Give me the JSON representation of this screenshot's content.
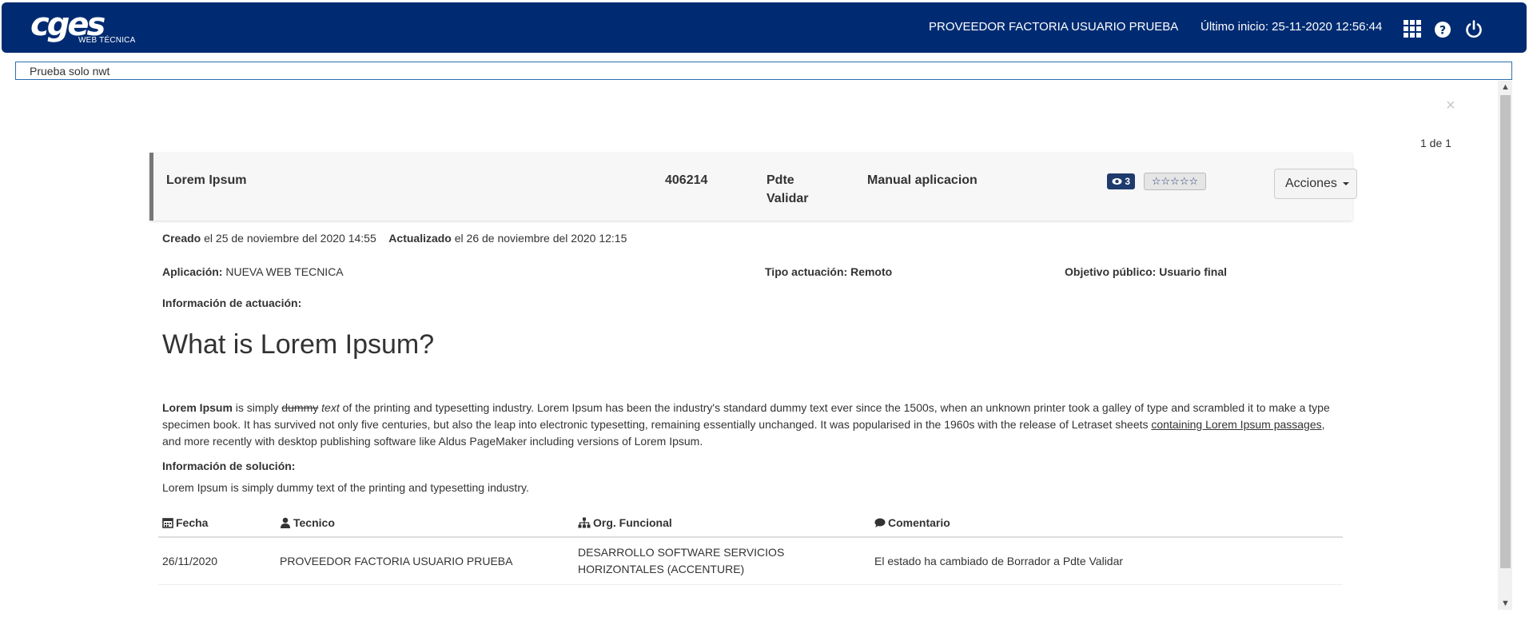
{
  "header": {
    "logo_text": "cges",
    "logo_subtitle": "WEB TÉCNICA",
    "user_name": "PROVEEDOR FACTORIA USUARIO PRUEBA",
    "last_login": "Último inicio: 25-11-2020 12:56:44",
    "icons": [
      "apps-grid-icon",
      "help-icon",
      "power-icon"
    ]
  },
  "notice": "Prueba solo nwt",
  "pager": "1 de 1",
  "close_label": "×",
  "ticket": {
    "title": "Lorem Ipsum",
    "id": "406214",
    "status": "Pdte Validar",
    "type": "Manual aplicacion",
    "views": "3",
    "rating": "☆☆☆☆☆",
    "actions_label": "Acciones"
  },
  "meta": {
    "created_label": "Creado",
    "created_value": " el 25 de noviembre del 2020 14:55",
    "updated_label": "Actualizado",
    "updated_value": " el 26 de noviembre del 2020 12:15",
    "app_label": "Aplicación:",
    "app_value": " NUEVA WEB TECNICA",
    "tipo": "Tipo actuación: Remoto",
    "objetivo": "Objetivo público: Usuario final",
    "info_label": "Información de actuación:"
  },
  "article": {
    "heading": "What is Lorem Ipsum?",
    "bold_lead": "Lorem Ipsum",
    "text_1": " is simply ",
    "strike": "dummy",
    "italic": " text",
    "text_2": " of the printing and typesetting industry. Lorem Ipsum has been the industry's standard dummy text ever since the 1500s, when an unknown printer took a galley of type and scrambled it to make a type specimen book. It has survived not only five centuries, but also the leap into electronic typesetting, remaining essentially unchanged. It was popularised in the 1960s with the release of Letraset sheets ",
    "link": "containing Lorem Ipsum passages",
    "text_3": ", and more recently with desktop publishing software like Aldus PageMaker including versions of Lorem Ipsum."
  },
  "solution": {
    "label": "Información de solución:",
    "text": "Lorem Ipsum is simply dummy text of the printing and typesetting industry."
  },
  "history": {
    "columns": [
      "Fecha",
      "Tecnico",
      "Org. Funcional",
      "Comentario"
    ],
    "rows": [
      {
        "fecha": "26/11/2020",
        "tecnico": "PROVEEDOR FACTORIA USUARIO PRUEBA",
        "org": "DESARROLLO SOFTWARE SERVICIOS HORIZONTALES (ACCENTURE)",
        "comentario": "El estado ha cambiado de Borrador a Pdte Validar"
      }
    ]
  },
  "colors": {
    "header_bg": "#002b72",
    "badge_bg": "#1f3b6e",
    "notice_border": "#2a6fb0"
  }
}
